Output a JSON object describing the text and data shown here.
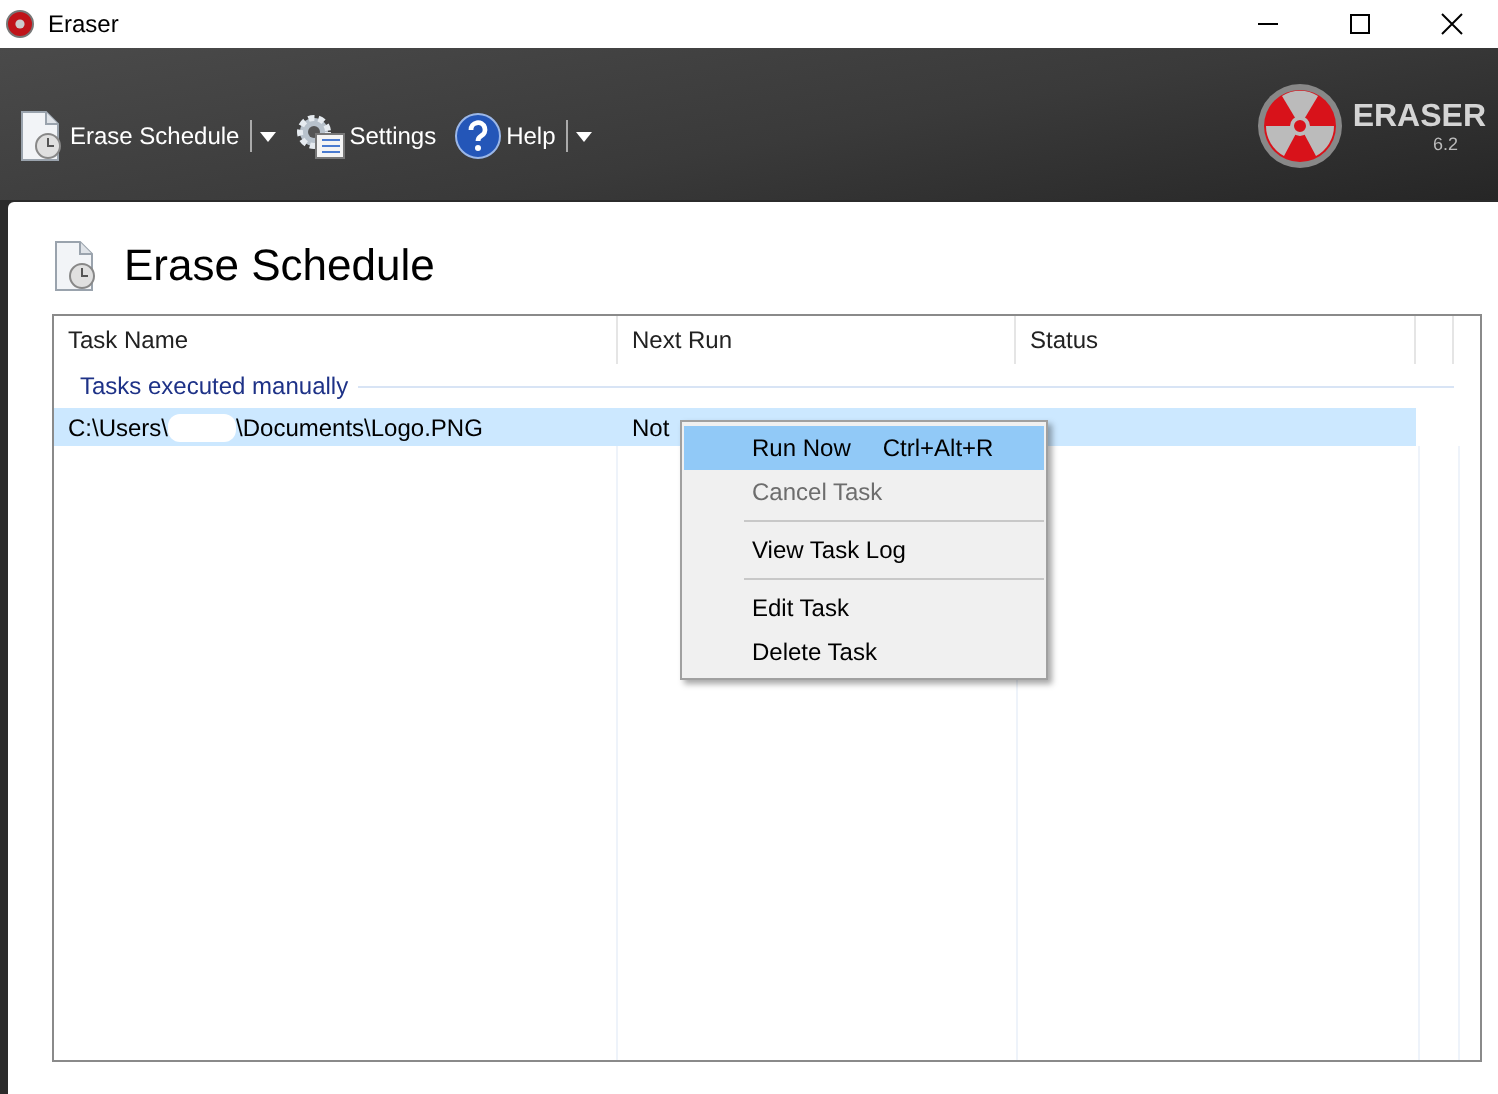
{
  "window": {
    "title": "Eraser"
  },
  "toolbar": [
    {
      "label": "Erase Schedule",
      "kind": "schedule",
      "dropdown": true
    },
    {
      "label": "Settings",
      "kind": "settings",
      "dropdown": false
    },
    {
      "label": "Help",
      "kind": "help",
      "dropdown": true
    }
  ],
  "logo": {
    "name": "ERASER",
    "version": "6.2"
  },
  "page_title": "Erase Schedule",
  "table": {
    "columns": [
      "Task Name",
      "Next Run",
      "Status"
    ],
    "group": "Tasks executed manually",
    "rows": [
      {
        "path_start": "C:\\Users\\",
        "path_end": "\\Documents\\Logo.PNG",
        "next_run": "Not",
        "selected": true
      }
    ]
  },
  "context_menu": [
    {
      "label": "Run Now",
      "shortcut": "Ctrl+Alt+R",
      "selected": true,
      "disabled": false,
      "separator_after": false
    },
    {
      "label": "Cancel Task",
      "selected": false,
      "disabled": true,
      "separator_after": true
    },
    {
      "label": "View Task Log",
      "selected": false,
      "disabled": false,
      "separator_after": true
    },
    {
      "label": "Edit Task",
      "selected": false,
      "disabled": false,
      "separator_after": false
    },
    {
      "label": "Delete Task",
      "selected": false,
      "disabled": false,
      "separator_after": false
    }
  ]
}
